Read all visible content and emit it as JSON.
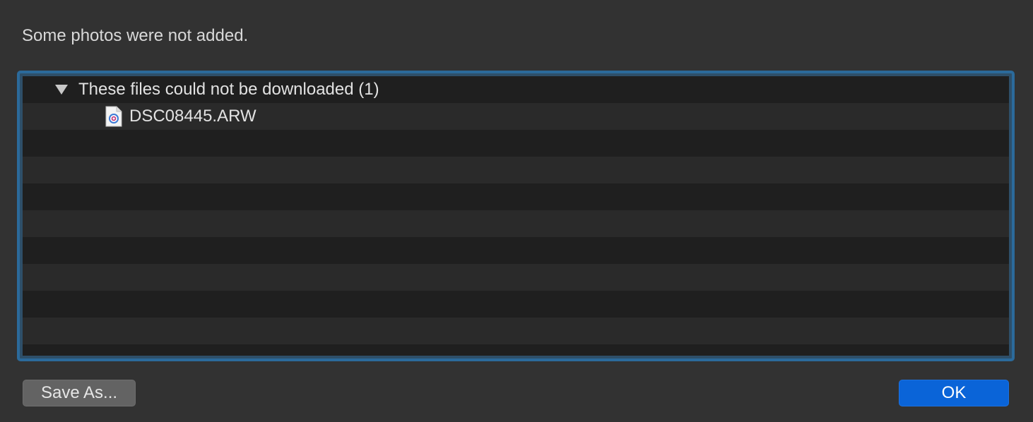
{
  "dialog": {
    "message": "Some photos were not added."
  },
  "list": {
    "group": {
      "label": "These files could not be downloaded (1)",
      "expanded": true,
      "items": [
        {
          "filename": "DSC08445.ARW",
          "icon": "raw-image-file-icon"
        }
      ]
    }
  },
  "buttons": {
    "save_as_label": "Save As...",
    "ok_label": "OK"
  },
  "colors": {
    "background": "#323232",
    "list_focus_ring": "#2b6a9b",
    "row_dark": "#1f1f1f",
    "row_light": "#2a2a2a",
    "ok_button": "#0a64d8",
    "secondary_button": "#636363"
  }
}
